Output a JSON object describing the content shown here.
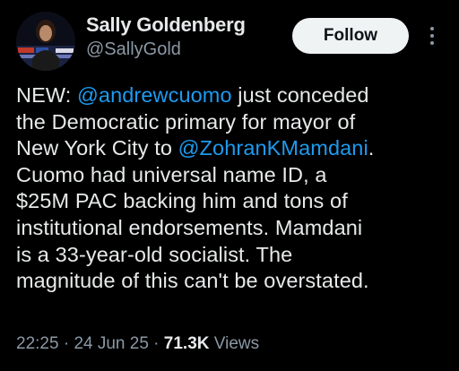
{
  "author": {
    "display_name": "Sally Goldenberg",
    "handle": "@SallyGold"
  },
  "follow_button": {
    "label": "Follow"
  },
  "more_menu": {
    "icon": "more-vertical-icon"
  },
  "tweet": {
    "lines": [
      [
        {
          "text": "NEW: "
        },
        {
          "text": "@andrewcuomo",
          "mention": true
        },
        {
          "text": " just conceded"
        }
      ],
      [
        {
          "text": "the Democratic primary for mayor of"
        }
      ],
      [
        {
          "text": "New York City to "
        },
        {
          "text": "@ZohranKMamdani",
          "mention": true
        },
        {
          "text": "."
        }
      ],
      [
        {
          "text": "Cuomo had universal name ID, a"
        }
      ],
      [
        {
          "text": "$25M PAC backing him and tons of"
        }
      ],
      [
        {
          "text": "institutional endorsements. Mamdani"
        }
      ],
      [
        {
          "text": "is a 33-year-old socialist. The"
        }
      ],
      [
        {
          "text": "magnitude of this can't be overstated."
        }
      ]
    ]
  },
  "meta": {
    "time": "22:25",
    "separator": " · ",
    "date": "24 Jun 25",
    "views_count": "71.3K",
    "views_label": " Views"
  },
  "colors": {
    "background": "#000000",
    "text": "#e7e9ea",
    "secondary": "#8b98a5",
    "link": "#1d9bf0",
    "follow_bg": "#eff3f4"
  }
}
